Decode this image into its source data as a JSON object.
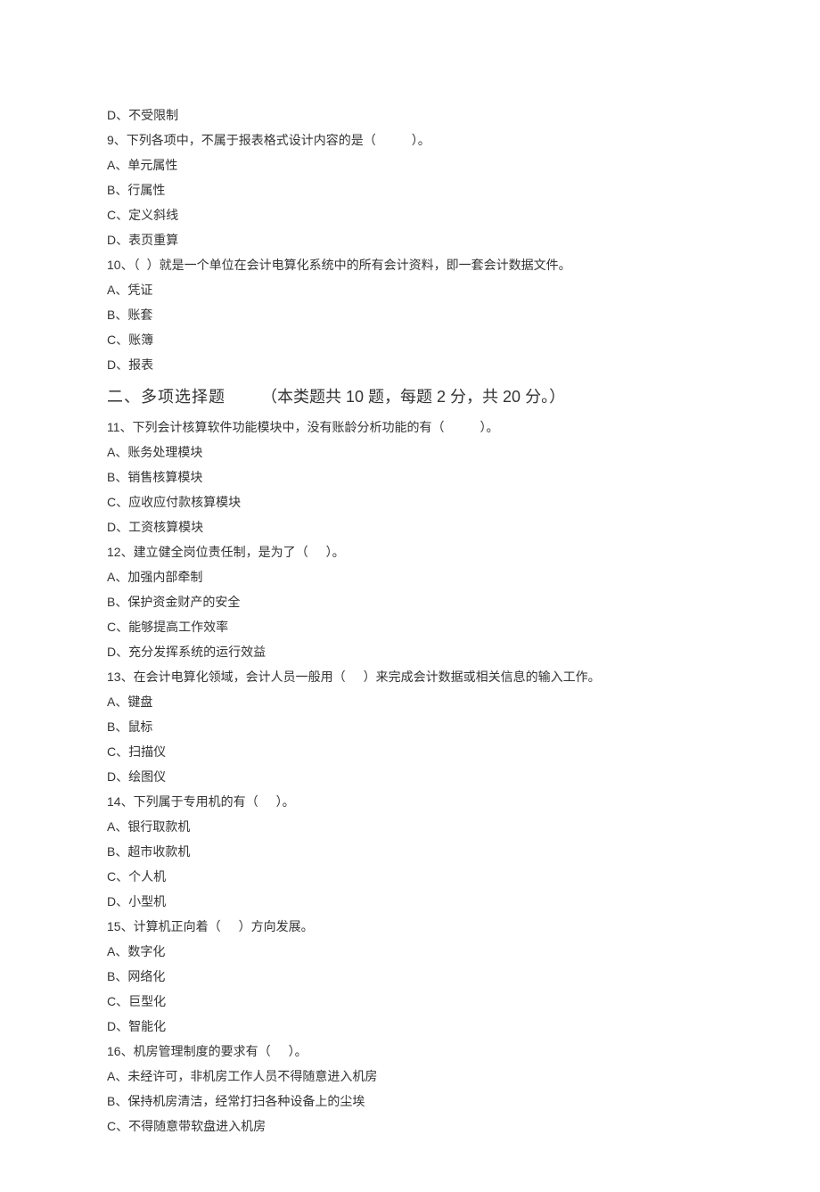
{
  "q8": {
    "optD": "D、不受限制"
  },
  "q9": {
    "stem_a": "9、下列各项中，不属于报表格式设计内容的是（",
    "stem_b": "）。",
    "A": "A、单元属性",
    "B": "B、行属性",
    "C": "C、定义斜线",
    "D": "D、表页重算"
  },
  "q10": {
    "stem_a": "10、（",
    "stem_b": "）就是一个单位在会计电算化系统中的所有会计资料，即一套会计数据文件。",
    "A": "A、凭证",
    "B": "B、账套",
    "C": "C、账簿",
    "D": "D、报表"
  },
  "section2": {
    "label": "二、多项选择题",
    "info_a": "（本类题共",
    "info_b": "10 题，每题 2 分，共 20 分。）"
  },
  "q11": {
    "stem_a": "11、下列会计核算软件功能模块中，没有账龄分析功能的有（",
    "stem_b": "）。",
    "A": "A、账务处理模块",
    "B": "B、销售核算模块",
    "C": "C、应收应付款核算模块",
    "D": "D、工资核算模块"
  },
  "q12": {
    "stem_a": "12、建立健全岗位责任制，是为了（",
    "stem_b": "）。",
    "A": "A、加强内部牵制",
    "B": "B、保护资金财产的安全",
    "C": "C、能够提高工作效率",
    "D": "D、充分发挥系统的运行效益"
  },
  "q13": {
    "stem_a": "13、在会计电算化领域，会计人员一般用（",
    "stem_b": "）来完成会计数据或相关信息的输入工作。",
    "A": "A、键盘",
    "B": "B、鼠标",
    "C": "C、扫描仪",
    "D": "D、绘图仪"
  },
  "q14": {
    "stem_a": "14、下列属于专用机的有（",
    "stem_b": "）。",
    "A": "A、银行取款机",
    "B": "B、超市收款机",
    "C": "C、个人机",
    "D": "D、小型机"
  },
  "q15": {
    "stem_a": "15、计算机正向着（",
    "stem_b": "）方向发展。",
    "A": "A、数字化",
    "B": "B、网络化",
    "C": "C、巨型化",
    "D": "D、智能化"
  },
  "q16": {
    "stem_a": "16、机房管理制度的要求有（",
    "stem_b": "）。",
    "A": "A、未经许可，非机房工作人员不得随意进入机房",
    "B": "B、保持机房清洁，经常打扫各种设备上的尘埃",
    "C": "C、不得随意带软盘进入机房"
  }
}
